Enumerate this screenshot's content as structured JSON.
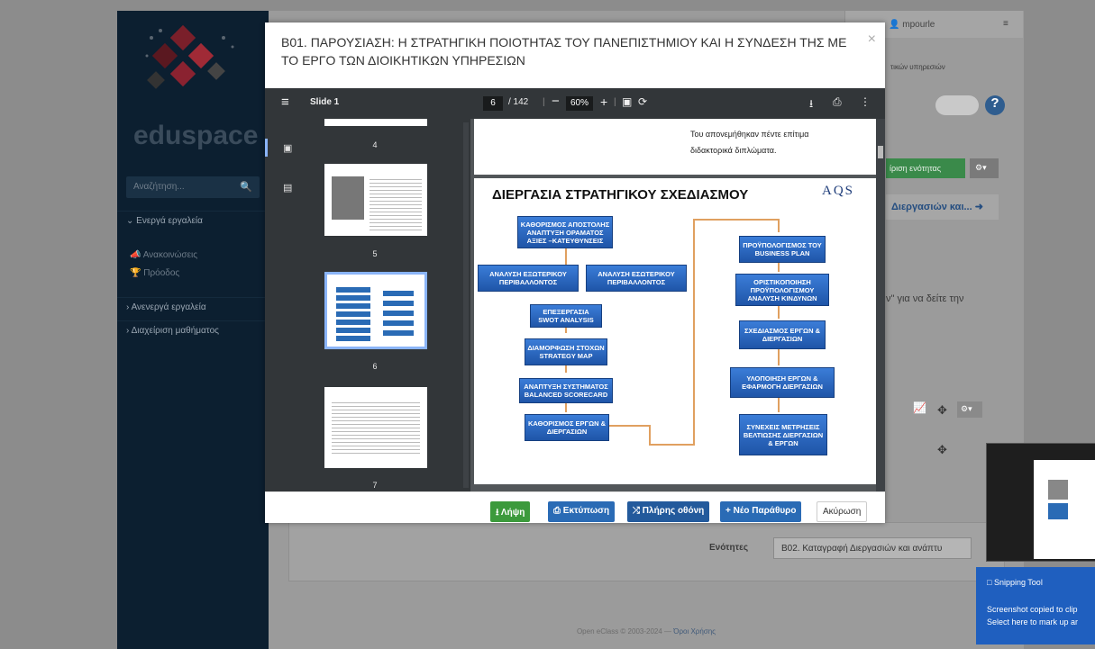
{
  "sidebar": {
    "logo_text": "eduspace",
    "search_placeholder": "Αναζήτηση...",
    "active_tools": "Ενεργά εργαλεία",
    "announcements": "Ανακοινώσεις",
    "progress": "Πρόοδος",
    "inactive_tools": "Ανενεργά εργαλεία",
    "course_admin": "Διαχείριση μαθήματος"
  },
  "background": {
    "user": "mpourle",
    "subtitle": "τικών υπηρεσιών",
    "unit_mgmt": "ίριση ενότητας",
    "next_link": "Διεργασιών και...",
    "hint": "ν\" για να δείτε την",
    "units_label": "Ενότητες",
    "units_select": "Β02. Καταγραφή Διεργασιών και ανάπτυ",
    "footer_text": "Open eClass © 2003-2024 — ",
    "footer_link": "Όροι Χρήσης"
  },
  "modal": {
    "title": "Β01. ΠΑΡΟΥΣΙΑΣΗ: Η ΣΤΡΑΤΗΓΙΚΗ ΠΟΙΟΤΗΤΑΣ ΤΟΥ ΠΑΝΕΠΙΣΤΗΜΙΟΥ ΚΑΙ Η ΣΥΝΔΕΣΗ ΤΗΣ ΜΕ ΤΟ ΕΡΓΟ ΤΩΝ ΔΙΟΙΚΗΤΙΚΩΝ ΥΠΗΡΕΣΙΩΝ",
    "close": "×"
  },
  "viewer": {
    "doc_name": "Slide 1",
    "page": "6",
    "total": "/ 142",
    "zoom": "60%",
    "thumb_labels": [
      "4",
      "5",
      "6",
      "7"
    ],
    "page5_text": [
      "Του απονεμήθηκαν πέντε επίτιμα",
      "διδακτορικά διπλώματα."
    ],
    "page6": {
      "title": "ΔΙΕΡΓΑΣΙΑ ΣΤΡΑΤΗΓΙΚΟΥ ΣΧΕΔΙΑΣΜΟΥ",
      "logo": "AQS",
      "left_boxes": [
        "ΚΑΘΟΡΙΣΜΟΣ ΑΠΟΣΤΟΛΗΣ ΑΝΑΠΤΥΞΗ ΟΡΑΜΑΤΟΣ ΑΞΙΕΣ –ΚΑΤΕΥΘΥΝΣΕΙΣ",
        "ΑΝΑΛΥΣΗ ΕΞΩΤΕΡΙΚΟΥ ΠΕΡΙΒΑΛΛΟΝΤΟΣ",
        "ΑΝΑΛΥΣΗ ΕΣΩΤΕΡΙΚΟΥ ΠΕΡΙΒΑΛΛΟΝΤΟΣ",
        "ΕΠΕΞΕΡΓΑΣΙΑ SWOT ANALYSIS",
        "ΔΙΑΜΟΡΦΩΣΗ ΣΤΟΧΩΝ STRATEGY MAP",
        "ΑΝΑΠΤΥΞΗ ΣΥΣΤΗΜΑΤΟΣ BALANCED SCORECARD",
        "ΚΑΘΟΡΙΣΜΟΣ ΕΡΓΩΝ & ΔΙΕΡΓΑΣΙΩΝ"
      ],
      "right_boxes": [
        "ΠΡΟΫΠΟΛΟΓΙΣΜΟΣ ΤΟΥ BUSINESS PLAN",
        "ΟΡΙΣΤΙΚΟΠΟΙΗΣΗ ΠΡΟΫΠΟΛΟΓΙΣΜΟΥ ΑΝΑΛΥΣΗ ΚΙΝΔΥΝΩΝ",
        "ΣΧΕΔΙΑΣΜΟΣ ΕΡΓΩΝ & ΔΙΕΡΓΑΣΙΩΝ",
        "ΥΛΟΠΟΙΗΣΗ ΕΡΓΩΝ & ΕΦΑΡΜΟΓΗ ΔΙΕΡΓΑΣΙΩΝ",
        "ΣΥΝΕΧΕΙΣ ΜΕΤΡΗΣΕΙΣ ΒΕΛΤΙΩΣΗΣ ΔΙΕΡΓΑΣΙΩΝ & ΕΡΓΩΝ"
      ]
    }
  },
  "footer": {
    "download": "Λήψη",
    "print": "Εκτύπωση",
    "fullscreen": "Πλήρης οθόνη",
    "new_window": "Νέο Παράθυρο",
    "cancel": "Ακύρωση"
  },
  "snip": {
    "title": "Snipping Tool",
    "line1": "Screenshot copied to clip",
    "line2": "Select here to mark up ar"
  },
  "colors": {
    "download": "#3c9a3c",
    "blue": "#2a6bb5",
    "dark_blue": "#235a9c"
  }
}
